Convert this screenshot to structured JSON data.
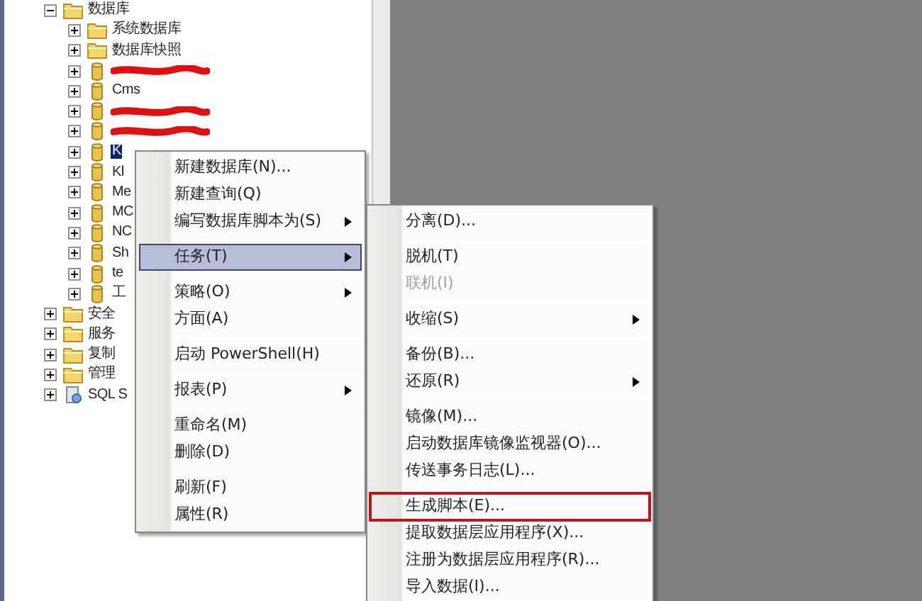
{
  "tree": [
    {
      "label": "数据库",
      "kind": "folder",
      "expanded": true,
      "selected": false,
      "children": [
        {
          "label": "系统数据库",
          "kind": "folder",
          "expanded": false,
          "selected": false
        },
        {
          "label": "数据库快照",
          "kind": "folder",
          "expanded": false,
          "selected": false
        },
        {
          "kind": "redacted",
          "expanded": false
        },
        {
          "label": "Cms",
          "kind": "database",
          "expanded": false,
          "selected": false
        },
        {
          "kind": "redacted",
          "expanded": false
        },
        {
          "kind": "redacted",
          "expanded": false
        },
        {
          "label": "K",
          "kind": "database",
          "expanded": false,
          "selected": true
        },
        {
          "label": "Kl",
          "kind": "database",
          "expanded": false,
          "selected": false
        },
        {
          "label": "Me",
          "kind": "database",
          "expanded": false,
          "selected": false
        },
        {
          "label": "MC",
          "kind": "database",
          "expanded": false,
          "selected": false
        },
        {
          "label": "NC",
          "kind": "database",
          "expanded": false,
          "selected": false
        },
        {
          "label": "Sh",
          "kind": "database",
          "expanded": false,
          "selected": false
        },
        {
          "label": "te",
          "kind": "database",
          "expanded": false,
          "selected": false
        },
        {
          "label": "工",
          "kind": "database",
          "expanded": false,
          "selected": false
        }
      ]
    },
    {
      "label": "安全",
      "kind": "folder",
      "expanded": false,
      "selected": false
    },
    {
      "label": "服务",
      "kind": "folder",
      "expanded": false,
      "selected": false
    },
    {
      "label": "复制",
      "kind": "folder",
      "expanded": false,
      "selected": false
    },
    {
      "label": "管理",
      "kind": "folder",
      "expanded": false,
      "selected": false
    },
    {
      "label": "SQL S",
      "kind": "agent",
      "expanded": false,
      "selected": false
    }
  ],
  "context_menu": [
    {
      "kind": "item",
      "label": "新建数据库(N)...",
      "submenu": false,
      "highlighted": false
    },
    {
      "kind": "item",
      "label": "新建查询(Q)",
      "submenu": false,
      "highlighted": false
    },
    {
      "kind": "item",
      "label": "编写数据库脚本为(S)",
      "submenu": true,
      "highlighted": false
    },
    {
      "kind": "separator"
    },
    {
      "kind": "item",
      "label": "任务(T)",
      "submenu": true,
      "highlighted": true
    },
    {
      "kind": "separator"
    },
    {
      "kind": "item",
      "label": "策略(O)",
      "submenu": true,
      "highlighted": false
    },
    {
      "kind": "item",
      "label": "方面(A)",
      "submenu": false,
      "highlighted": false
    },
    {
      "kind": "separator"
    },
    {
      "kind": "item",
      "label": "启动 PowerShell(H)",
      "submenu": false,
      "highlighted": false
    },
    {
      "kind": "separator"
    },
    {
      "kind": "item",
      "label": "报表(P)",
      "submenu": true,
      "highlighted": false
    },
    {
      "kind": "separator"
    },
    {
      "kind": "item",
      "label": "重命名(M)",
      "submenu": false,
      "highlighted": false
    },
    {
      "kind": "item",
      "label": "删除(D)",
      "submenu": false,
      "highlighted": false
    },
    {
      "kind": "separator"
    },
    {
      "kind": "item",
      "label": "刷新(F)",
      "submenu": false,
      "highlighted": false
    },
    {
      "kind": "item",
      "label": "属性(R)",
      "submenu": false,
      "highlighted": false
    }
  ],
  "tasks_submenu": [
    {
      "kind": "item",
      "label": "分离(D)...",
      "submenu": false,
      "disabled": false,
      "outlined": false
    },
    {
      "kind": "separator"
    },
    {
      "kind": "item",
      "label": "脱机(T)",
      "submenu": false,
      "disabled": false,
      "outlined": false
    },
    {
      "kind": "item",
      "label": "联机(I)",
      "submenu": false,
      "disabled": true,
      "outlined": false
    },
    {
      "kind": "separator"
    },
    {
      "kind": "item",
      "label": "收缩(S)",
      "submenu": true,
      "disabled": false,
      "outlined": false
    },
    {
      "kind": "separator"
    },
    {
      "kind": "item",
      "label": "备份(B)...",
      "submenu": false,
      "disabled": false,
      "outlined": false
    },
    {
      "kind": "item",
      "label": "还原(R)",
      "submenu": true,
      "disabled": false,
      "outlined": false
    },
    {
      "kind": "separator"
    },
    {
      "kind": "item",
      "label": "镜像(M)...",
      "submenu": false,
      "disabled": false,
      "outlined": false
    },
    {
      "kind": "item",
      "label": "启动数据库镜像监视器(O)...",
      "submenu": false,
      "disabled": false,
      "outlined": false
    },
    {
      "kind": "item",
      "label": "传送事务日志(L)...",
      "submenu": false,
      "disabled": false,
      "outlined": false
    },
    {
      "kind": "separator"
    },
    {
      "kind": "item",
      "label": "生成脚本(E)...",
      "submenu": false,
      "disabled": false,
      "outlined": true
    },
    {
      "kind": "item",
      "label": "提取数据层应用程序(X)...",
      "submenu": false,
      "disabled": false,
      "outlined": false
    },
    {
      "kind": "item",
      "label": "注册为数据层应用程序(R)...",
      "submenu": false,
      "disabled": false,
      "outlined": false
    },
    {
      "kind": "item",
      "label": "导入数据(I)...",
      "submenu": false,
      "disabled": false,
      "outlined": false
    }
  ]
}
